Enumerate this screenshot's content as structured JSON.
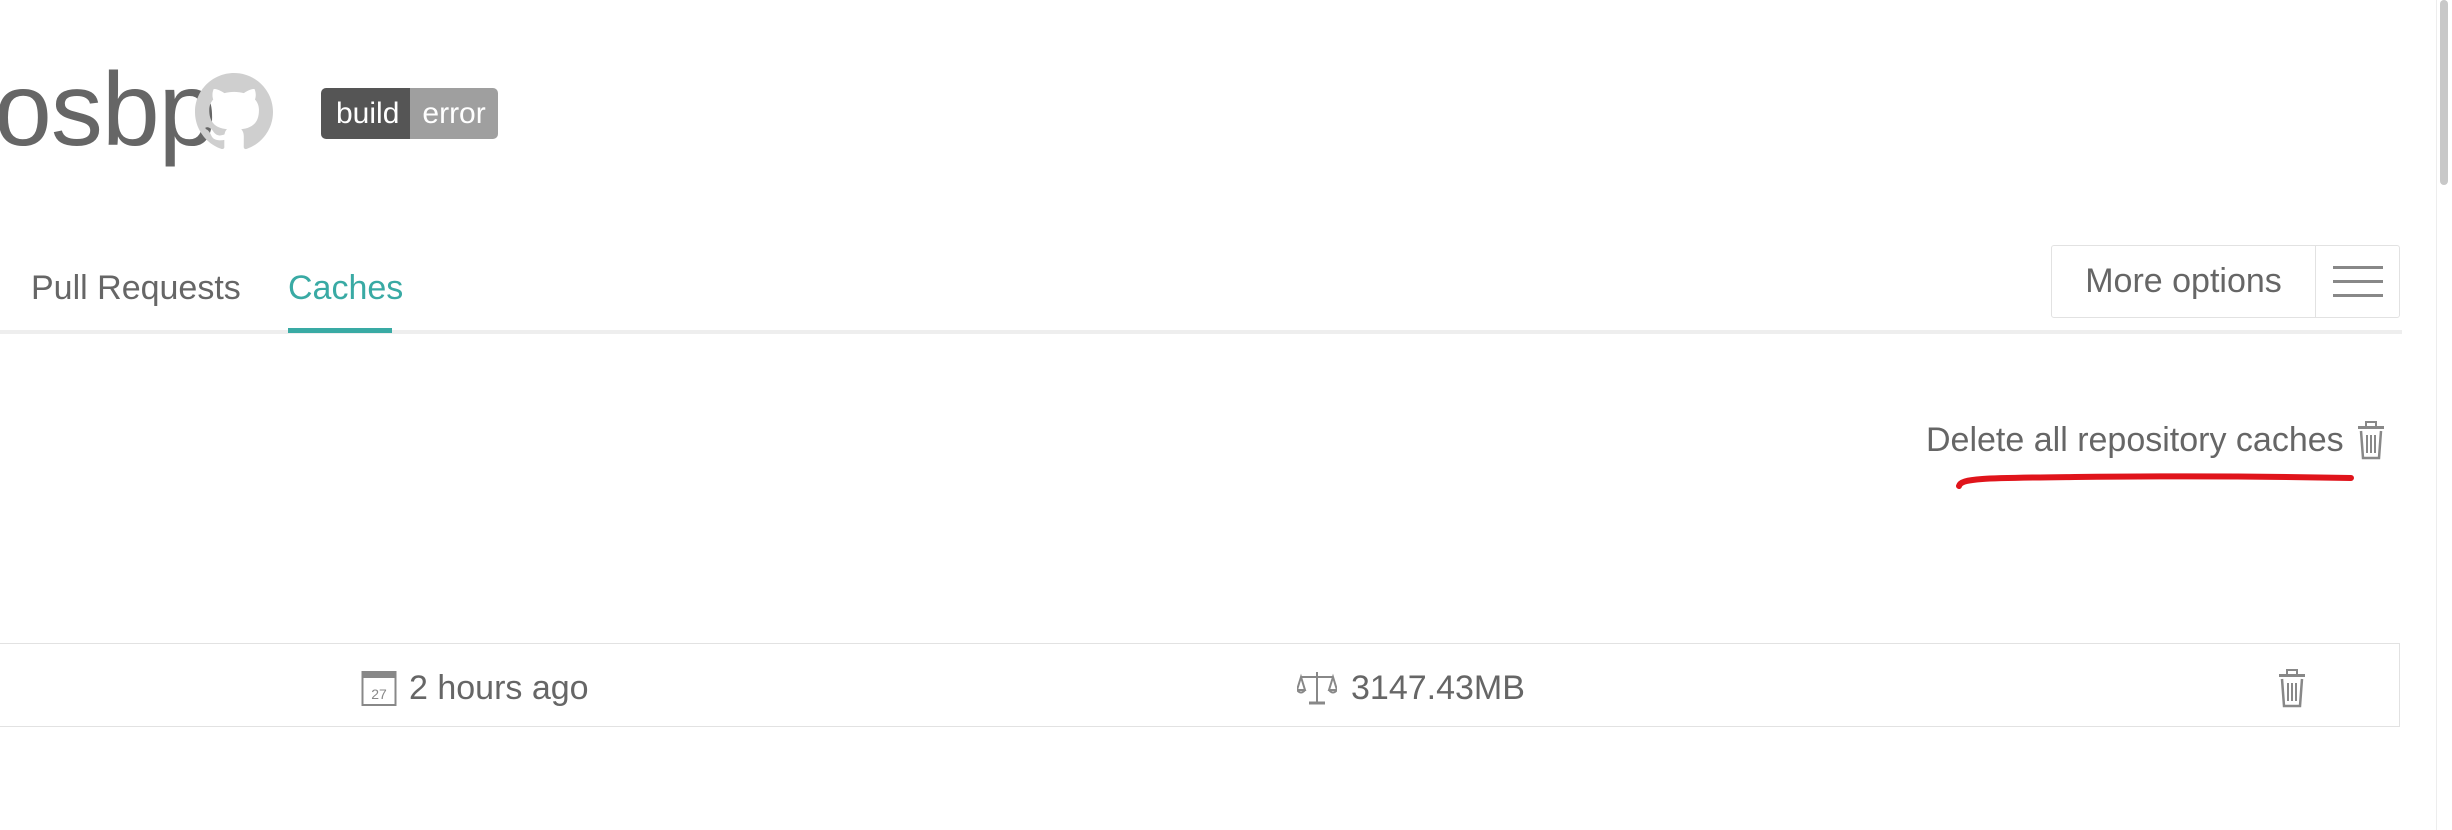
{
  "repo": {
    "title": "osbp",
    "github_icon": "github-icon"
  },
  "badge": {
    "left_label": "build",
    "right_label": "error",
    "left_color": "#555555",
    "right_color": "#9f9f9f"
  },
  "tabs": [
    {
      "label": "Pull Requests",
      "active": false
    },
    {
      "label": "Caches",
      "active": true
    }
  ],
  "colors": {
    "accent": "#39aaa4",
    "annotation": "#e0141b",
    "text": "#666666"
  },
  "more_options": {
    "label": "More options",
    "icon": "hamburger-menu-icon"
  },
  "caches": {
    "delete_all_label": "Delete all repository caches",
    "delete_all_icon": "trash-icon",
    "rows": [
      {
        "calendar_day": "27",
        "date_label": "2 hours ago",
        "size_label": "3147.43MB",
        "date_icon": "calendar-icon",
        "size_icon": "scale-icon",
        "delete_icon": "trash-icon"
      }
    ]
  }
}
